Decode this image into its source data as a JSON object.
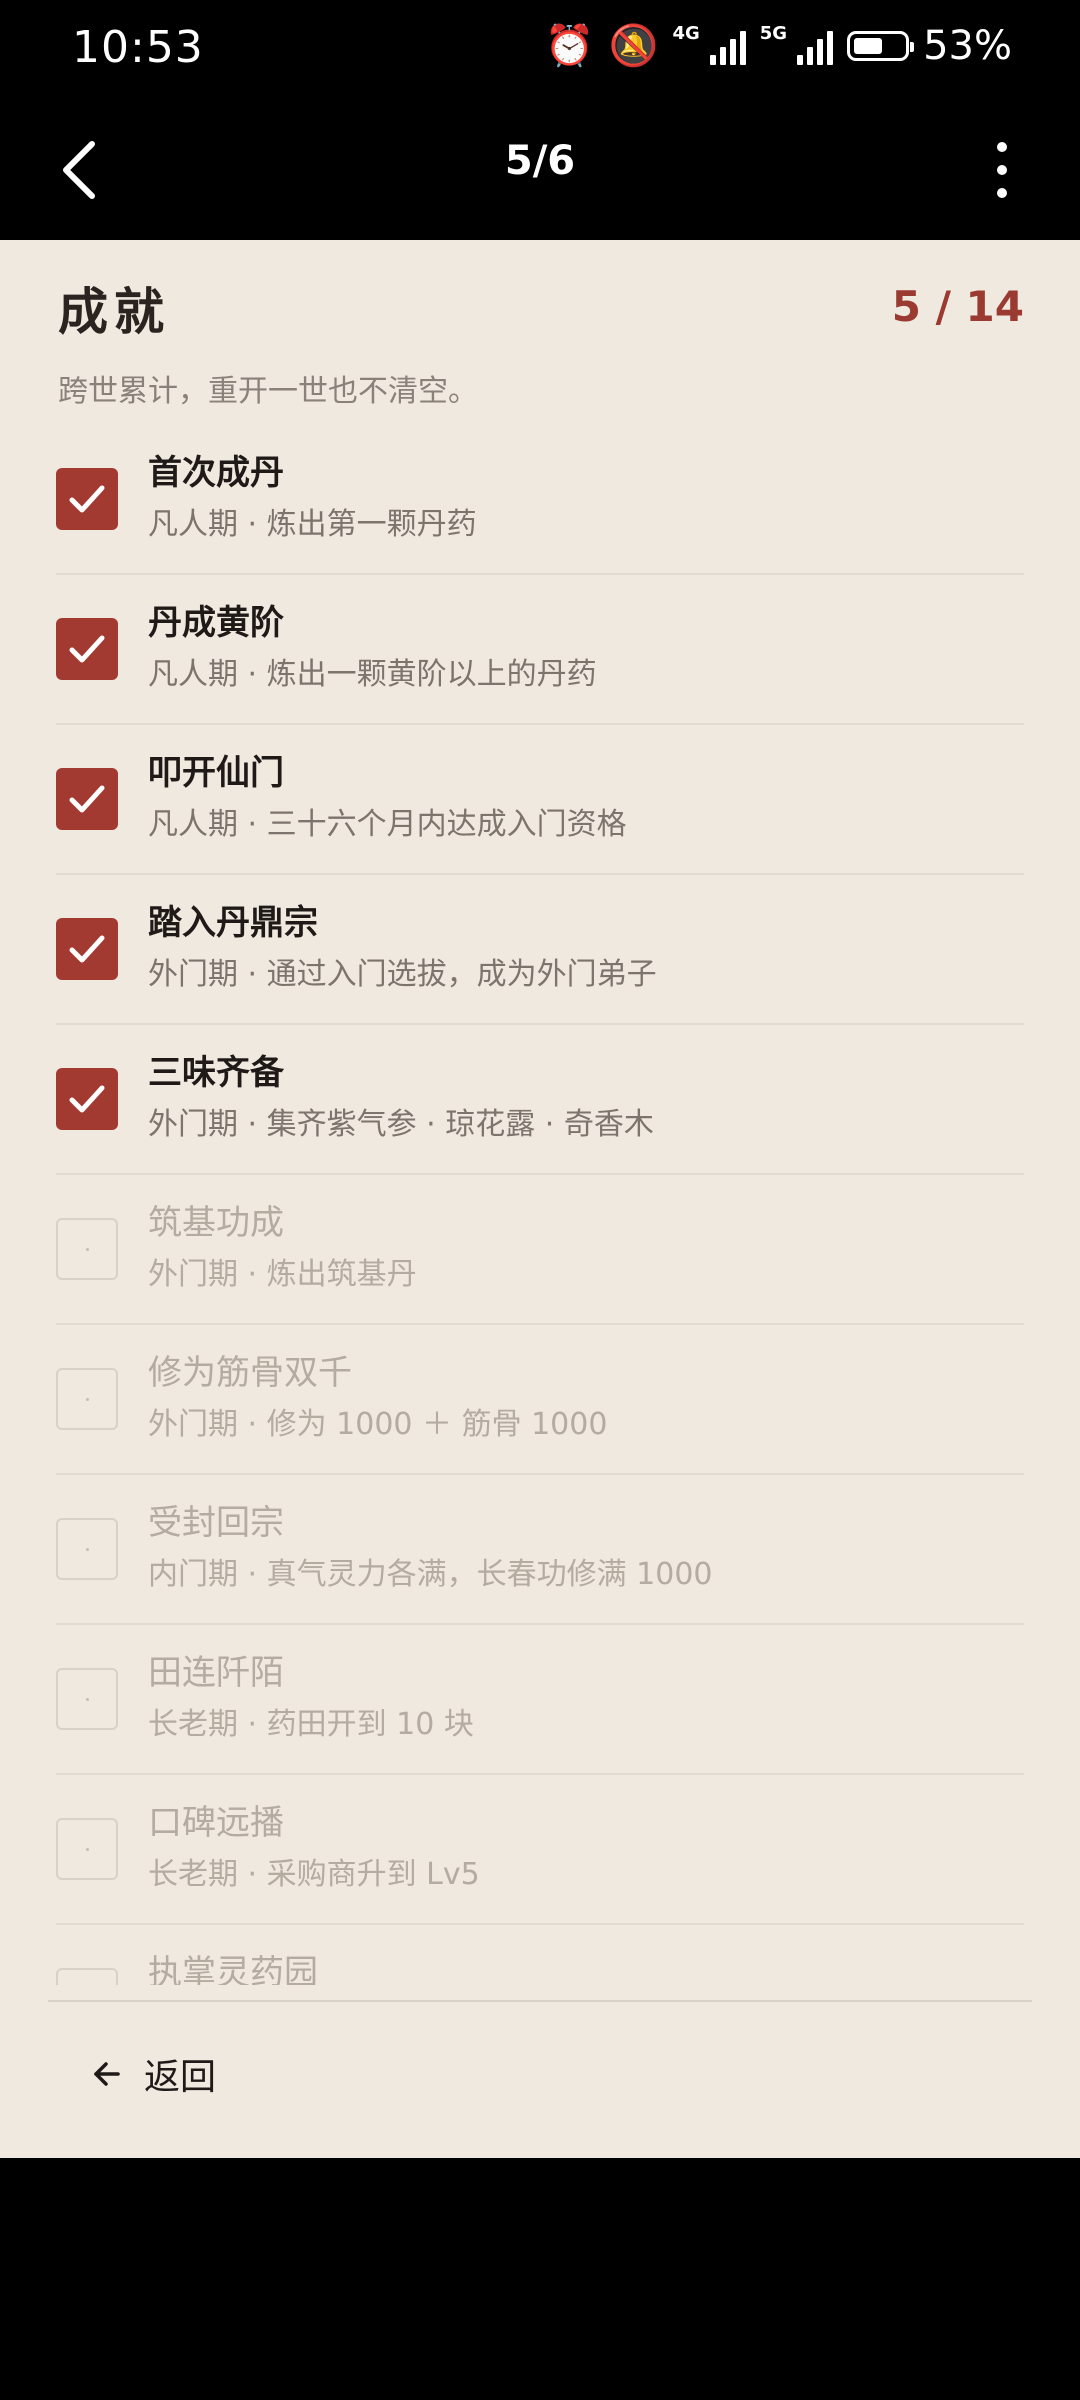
{
  "status_bar": {
    "time": "10:53",
    "battery": "53%",
    "net1": "4G",
    "net2": "5G"
  },
  "app_bar": {
    "title": "5/6"
  },
  "header": {
    "title": "成就",
    "count": "5 / 14",
    "subtitle": "跨世累计，重开一世也不清空。"
  },
  "achievements": [
    {
      "title": "首次成丹",
      "desc": "凡人期 · 炼出第一颗丹药",
      "done": true
    },
    {
      "title": "丹成黄阶",
      "desc": "凡人期 · 炼出一颗黄阶以上的丹药",
      "done": true
    },
    {
      "title": "叩开仙门",
      "desc": "凡人期 · 三十六个月内达成入门资格",
      "done": true
    },
    {
      "title": "踏入丹鼎宗",
      "desc": "外门期 · 通过入门选拔，成为外门弟子",
      "done": true
    },
    {
      "title": "三味齐备",
      "desc": "外门期 · 集齐紫气参 · 琼花露 · 奇香木",
      "done": true
    },
    {
      "title": "筑基功成",
      "desc": "外门期 · 炼出筑基丹",
      "done": false
    },
    {
      "title": "修为筋骨双千",
      "desc": "外门期 · 修为 1000 ＋ 筋骨 1000",
      "done": false
    },
    {
      "title": "受封回宗",
      "desc": "内门期 · 真气灵力各满，长春功修满 1000",
      "done": false
    },
    {
      "title": "田连阡陌",
      "desc": "长老期 · 药田开到 10 块",
      "done": false
    },
    {
      "title": "口碑远播",
      "desc": "长老期 · 采购商升到 Lv5",
      "done": false
    },
    {
      "title": "执掌灵药园",
      "desc": "",
      "done": false
    }
  ],
  "footer": {
    "back_label": "返回"
  },
  "colors": {
    "accent": "#a33a32",
    "panel_bg": "#efe9e0",
    "count_color": "#9a3a30"
  }
}
